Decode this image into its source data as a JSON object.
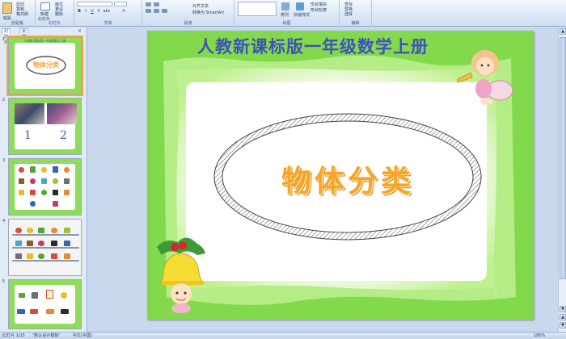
{
  "ribbon": {
    "groups": [
      {
        "name": "剪贴板",
        "buttons": [
          "粘贴",
          "剪切",
          "复制",
          "格式刷"
        ]
      },
      {
        "name": "幻灯片",
        "buttons": [
          "新建",
          "幻灯片",
          "版式",
          "重设",
          "删除"
        ]
      },
      {
        "name": "字体",
        "buttons": [
          "B",
          "I",
          "U",
          "S",
          "abc",
          "A"
        ]
      },
      {
        "name": "段落",
        "buttons": [
          "对齐文本",
          "转换为 SmartArt"
        ]
      },
      {
        "name": "绘图",
        "buttons": [
          "排列",
          "快速样式",
          "形状填充",
          "形状轮廓"
        ]
      },
      {
        "name": "编辑",
        "buttons": [
          "查找",
          "替换",
          "选择"
        ]
      }
    ]
  },
  "left_panel": {
    "tabs": [
      "幻灯片",
      "大纲"
    ],
    "close_glyph": "×",
    "slides": [
      {
        "num": "1",
        "title": "人教新课标版一年级数学上册",
        "caption": "物体分类"
      },
      {
        "num": "2",
        "labels": [
          "1",
          "2"
        ]
      },
      {
        "num": "3"
      },
      {
        "num": "4"
      },
      {
        "num": "5"
      }
    ]
  },
  "slide": {
    "title": "人教新课标版一年级数学上册",
    "main_text": "物体分类",
    "colors": {
      "frame_green": "#82d94c",
      "title_blue": "#3f52b7",
      "text_orange": "#f5a52b"
    }
  },
  "status": {
    "slide_counter": "幻灯片 1/15",
    "theme": "\"默认设计模板\"",
    "language": "中文(中国)",
    "zoom": "180%"
  },
  "colors": {
    "ribbon_bg": "#dbe7f6",
    "window_bg": "#c9d8ec",
    "selection": "#f3a845"
  }
}
